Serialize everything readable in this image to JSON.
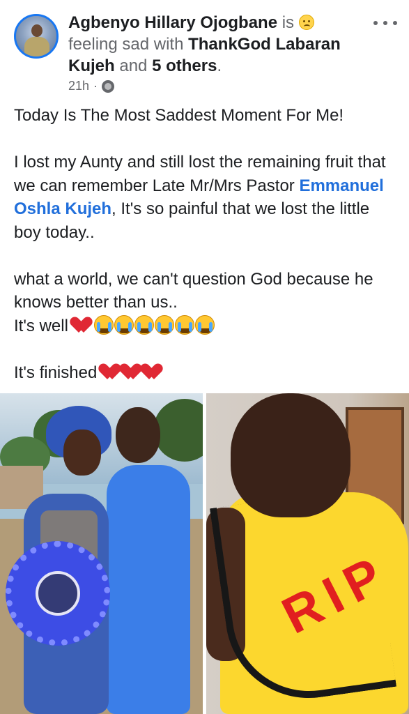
{
  "post": {
    "author": "Agbenyo Hillary Ojogbane",
    "status_is": "is",
    "feeling_text": "feeling sad with",
    "tagged_name": "ThankGod Labaran Kujeh",
    "and_text": "and",
    "others_text": "5 others",
    "period": ".",
    "time": "21h",
    "separator": "·",
    "paragraphs": {
      "p1": "Today Is The Most Saddest Moment For Me!",
      "p2_before": "I lost my Aunty and still lost the remaining fruit that we can remember Late Mr/Mrs Pastor ",
      "p2_link": "Emmanuel Oshla Kujeh",
      "p2_after": ", It's so painful that we lost the little boy today..",
      "p3_line1": "what a world, we can't question God because he knows better than us..",
      "p3_line2": "It's well",
      "p4": "It's finished"
    },
    "rip_text": "RIP"
  },
  "icons": {
    "feeling": "sad-face-icon",
    "privacy": "globe-icon",
    "menu": "more-icon",
    "broken_heart": "broken-heart-icon",
    "crying": "crying-face-icon"
  },
  "colors": {
    "link": "#216fdb",
    "muted": "#65676b",
    "avatar_ring": "#1877f2",
    "rip_red": "#e11f1f"
  }
}
